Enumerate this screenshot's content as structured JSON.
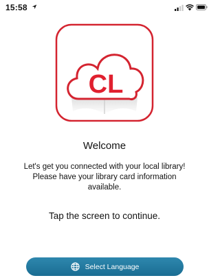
{
  "status_bar": {
    "time": "15:58",
    "icons": [
      "location-arrow-icon",
      "cellular-signal-icon",
      "wifi-icon",
      "battery-icon"
    ]
  },
  "logo": {
    "text": "CL",
    "brand_color": "#e0202f"
  },
  "welcome": {
    "title": "Welcome",
    "intro_lines": [
      "Let's get you connected with your local library!",
      "Please have your library card information",
      "available."
    ],
    "tap_hint": "Tap the screen to continue."
  },
  "language_button": {
    "icon": "globe-icon",
    "label": "Select Language",
    "color": "#2478a0"
  }
}
